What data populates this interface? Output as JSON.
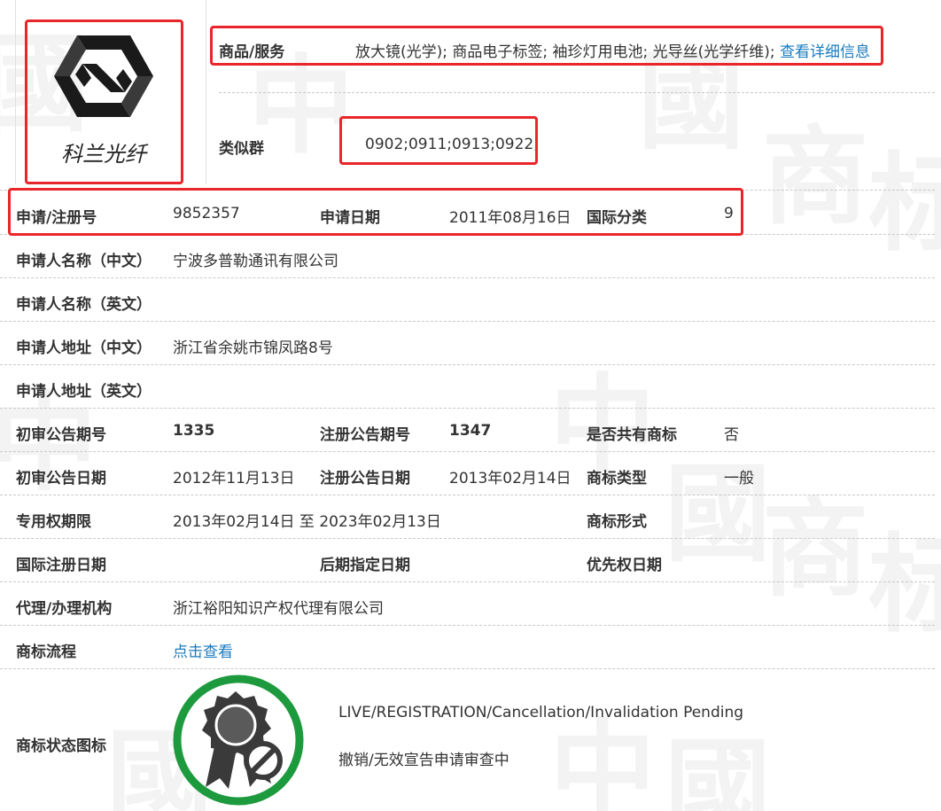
{
  "logo": {
    "text": "科兰光纤"
  },
  "goods": {
    "label": "商品/服务",
    "value": "放大镜(光学); 商品电子标签; 袖珍灯用电池; 光导丝(光学纤维); ",
    "link": "查看详细信息"
  },
  "similar_group": {
    "label": "类似群",
    "value": "0902;0911;0913;0922;"
  },
  "reg_row": {
    "reg_no_label": "申请/注册号",
    "reg_no": "9852357",
    "apply_date_label": "申请日期",
    "apply_date": "2011年08月16日",
    "intl_class_label": "国际分类",
    "intl_class": "9"
  },
  "applicant": {
    "name_cn_label": "申请人名称（中文）",
    "name_cn": "宁波多普勒通讯有限公司",
    "name_en_label": "申请人名称（英文）",
    "name_en": "",
    "addr_cn_label": "申请人地址（中文）",
    "addr_cn": "浙江省余姚市锦凤路8号",
    "addr_en_label": "申请人地址（英文）",
    "addr_en": ""
  },
  "announce": {
    "prelim_no_label": "初审公告期号",
    "prelim_no": "1335",
    "reg_no_label": "注册公告期号",
    "reg_no": "1347",
    "shared_label": "是否共有商标",
    "shared": "否",
    "prelim_date_label": "初审公告日期",
    "prelim_date": "2012年11月13日",
    "reg_date_label": "注册公告日期",
    "reg_date": "2013年02月14日",
    "mark_type_label": "商标类型",
    "mark_type": "一般"
  },
  "rights": {
    "term_label": "专用权期限",
    "term": "2013年02月14日 至 2023年02月13日",
    "form_label": "商标形式",
    "form": "",
    "intl_reg_date_label": "国际注册日期",
    "later_date_label": "后期指定日期",
    "priority_date_label": "优先权日期"
  },
  "agent": {
    "label": "代理/办理机构",
    "value": "浙江裕阳知识产权代理有限公司"
  },
  "process": {
    "label": "商标流程",
    "link": "点击查看"
  },
  "status": {
    "label": "商标状态图标",
    "en": "LIVE/REGISTRATION/Cancellation/Invalidation Pending",
    "cn": "撤销/无效宣告申请审查中"
  },
  "colors": {
    "highlight_box": "#e8262b",
    "link": "#1a7bbf",
    "status_ring": "#1e9a3e",
    "status_icon": "#3a3a3a"
  }
}
